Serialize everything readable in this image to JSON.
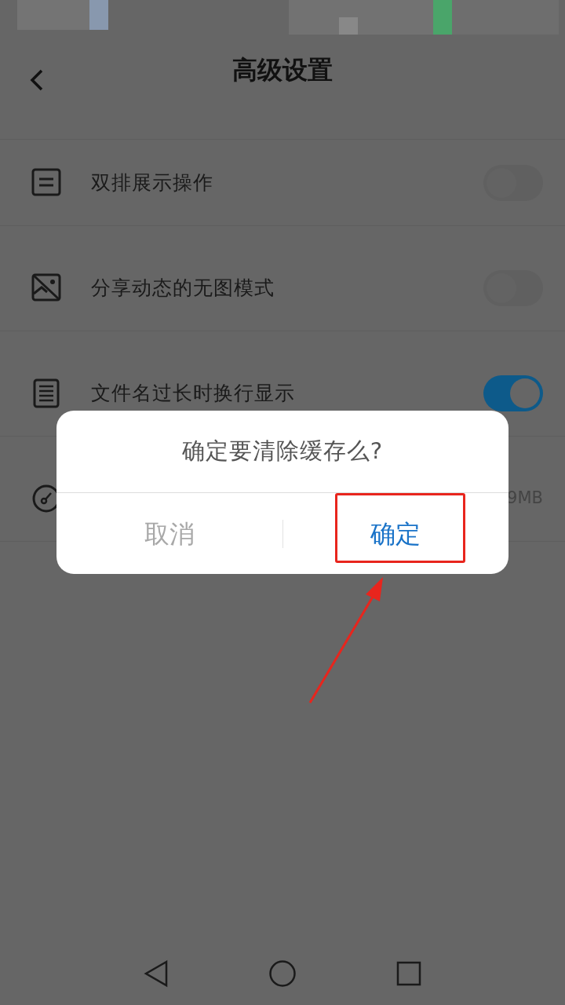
{
  "header": {
    "title": "高级设置"
  },
  "settings": [
    {
      "kind": "toggle",
      "label": "双排展示操作",
      "on": false
    },
    {
      "kind": "toggle",
      "label": "分享动态的无图模式",
      "on": false
    },
    {
      "kind": "toggle",
      "label": "文件名过长时换行显示",
      "on": true
    },
    {
      "kind": "value",
      "value": "9MB"
    }
  ],
  "dialog": {
    "message": "确定要清除缓存么?",
    "buttons": [
      {
        "label": "取消",
        "kind": "cancel"
      },
      {
        "label": "确定",
        "kind": "confirm"
      }
    ]
  }
}
